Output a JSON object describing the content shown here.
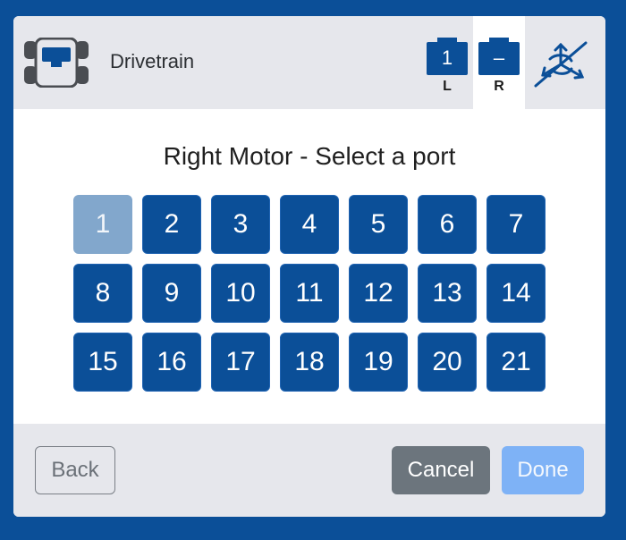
{
  "header": {
    "device_icon": "drivetrain-icon",
    "title": "Drivetrain",
    "motors": [
      {
        "symbol": "1",
        "label": "L",
        "selected": false
      },
      {
        "symbol": "–",
        "label": "R",
        "selected": true
      }
    ],
    "gyro_icon": "gyro-disabled-icon"
  },
  "main": {
    "prompt": "Right Motor - Select a port",
    "ports": [
      {
        "label": "1",
        "disabled": true
      },
      {
        "label": "2"
      },
      {
        "label": "3"
      },
      {
        "label": "4"
      },
      {
        "label": "5"
      },
      {
        "label": "6"
      },
      {
        "label": "7"
      },
      {
        "label": "8"
      },
      {
        "label": "9"
      },
      {
        "label": "10"
      },
      {
        "label": "11"
      },
      {
        "label": "12"
      },
      {
        "label": "13"
      },
      {
        "label": "14"
      },
      {
        "label": "15"
      },
      {
        "label": "16"
      },
      {
        "label": "17"
      },
      {
        "label": "18"
      },
      {
        "label": "19"
      },
      {
        "label": "20"
      },
      {
        "label": "21"
      }
    ]
  },
  "footer": {
    "back_label": "Back",
    "cancel_label": "Cancel",
    "done_label": "Done"
  },
  "colors": {
    "brand_blue": "#0b4f98",
    "disabled_port": "#82a7cc",
    "cancel_gray": "#6c757d",
    "done_disabled": "#7eb2f6",
    "panel_gray": "#e6e7ec"
  }
}
